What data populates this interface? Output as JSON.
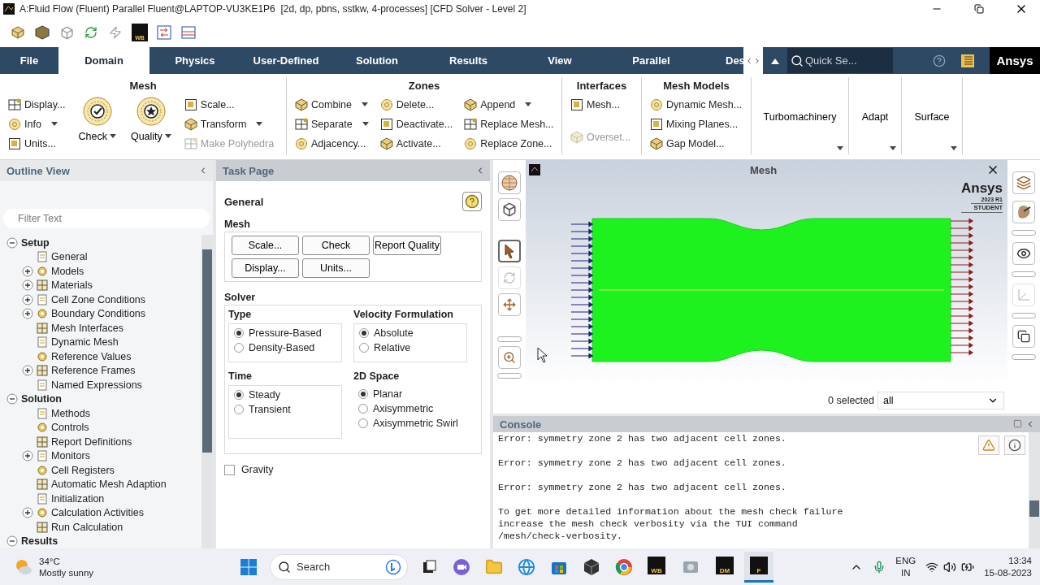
{
  "window": {
    "title": "A:Fluid Flow (Fluent) Parallel Fluent@LAPTOP-VU3KE1P6  [2d, dp, pbns, sstkw, 4-processes] [CFD Solver - Level 2]"
  },
  "quick_toolbar": {
    "badge": "WB"
  },
  "ribbon_tabs": [
    {
      "label": "File",
      "selected": false
    },
    {
      "label": "Domain",
      "selected": true
    },
    {
      "label": "Physics",
      "selected": false
    },
    {
      "label": "User-Defined",
      "selected": false
    },
    {
      "label": "Solution",
      "selected": false
    },
    {
      "label": "Results",
      "selected": false
    },
    {
      "label": "View",
      "selected": false
    },
    {
      "label": "Parallel",
      "selected": false
    },
    {
      "label": "Des",
      "selected": false
    }
  ],
  "quick_search": {
    "placeholder": "Quick Se..."
  },
  "brand": "Ansys",
  "ribbon_groups": [
    {
      "kind": "tools",
      "title": "Mesh",
      "columns": [
        [
          {
            "label": "Display...",
            "kind": "small",
            "dropdown": false,
            "disabled": false
          },
          {
            "label": "Info",
            "kind": "small",
            "dropdown": true,
            "disabled": false
          },
          {
            "label": "Units...",
            "kind": "small",
            "dropdown": false,
            "disabled": false
          }
        ],
        [
          {
            "label": "Check",
            "kind": "large",
            "dropdown": true,
            "disabled": false
          }
        ],
        [
          {
            "label": "Quality",
            "kind": "large",
            "dropdown": true,
            "disabled": false
          }
        ],
        [
          {
            "label": "Scale...",
            "kind": "small",
            "dropdown": false,
            "disabled": false
          },
          {
            "label": "Transform",
            "kind": "small",
            "dropdown": true,
            "disabled": false
          },
          {
            "label": "Make Polyhedra",
            "kind": "small",
            "dropdown": false,
            "disabled": true
          }
        ]
      ]
    },
    {
      "kind": "tools",
      "title": "Zones",
      "columns": [
        [
          {
            "label": "Combine",
            "kind": "small",
            "dropdown": true,
            "disabled": false
          },
          {
            "label": "Separate",
            "kind": "small",
            "dropdown": true,
            "disabled": false
          },
          {
            "label": "Adjacency...",
            "kind": "small",
            "dropdown": false,
            "disabled": false
          }
        ],
        [
          {
            "label": "Delete...",
            "kind": "small",
            "dropdown": false,
            "disabled": false
          },
          {
            "label": "Deactivate...",
            "kind": "small",
            "dropdown": false,
            "disabled": false
          },
          {
            "label": "Activate...",
            "kind": "small",
            "dropdown": false,
            "disabled": false
          }
        ],
        [
          {
            "label": "Append",
            "kind": "small",
            "dropdown": true,
            "disabled": false
          },
          {
            "label": "Replace Mesh...",
            "kind": "small",
            "dropdown": false,
            "disabled": false
          },
          {
            "label": "Replace Zone...",
            "kind": "small",
            "dropdown": false,
            "disabled": false
          }
        ]
      ]
    },
    {
      "kind": "tools",
      "title": "Interfaces",
      "columns": [
        [
          {
            "label": "Mesh...",
            "kind": "small",
            "dropdown": false,
            "disabled": false
          },
          {
            "label": "Overset...",
            "kind": "small",
            "dropdown": false,
            "disabled": true
          }
        ]
      ]
    },
    {
      "kind": "tools",
      "title": "Mesh Models",
      "columns": [
        [
          {
            "label": "Dynamic Mesh...",
            "kind": "small",
            "dropdown": false,
            "disabled": false
          },
          {
            "label": "Mixing Planes...",
            "kind": "small",
            "dropdown": false,
            "disabled": false
          },
          {
            "label": "Gap Model...",
            "kind": "small",
            "dropdown": false,
            "disabled": false
          }
        ]
      ]
    },
    {
      "kind": "menu",
      "title": "Turbomachinery"
    },
    {
      "kind": "menu",
      "title": "Adapt"
    },
    {
      "kind": "menu",
      "title": "Surface"
    }
  ],
  "outline": {
    "title": "Outline View",
    "filter_placeholder": "Filter Text",
    "tree": [
      {
        "label": "Setup",
        "kind": "folder",
        "expanded": true,
        "children": [
          {
            "label": "General",
            "kind": "leaf"
          },
          {
            "label": "Models",
            "kind": "folder",
            "expanded": false
          },
          {
            "label": "Materials",
            "kind": "folder",
            "expanded": false
          },
          {
            "label": "Cell Zone Conditions",
            "kind": "folder",
            "expanded": false
          },
          {
            "label": "Boundary Conditions",
            "kind": "folder",
            "expanded": false
          },
          {
            "label": "Mesh Interfaces",
            "kind": "leaf"
          },
          {
            "label": "Dynamic Mesh",
            "kind": "leaf"
          },
          {
            "label": "Reference Values",
            "kind": "leaf"
          },
          {
            "label": "Reference Frames",
            "kind": "folder",
            "expanded": false
          },
          {
            "label": "Named Expressions",
            "kind": "leaf"
          }
        ]
      },
      {
        "label": "Solution",
        "kind": "folder",
        "expanded": true,
        "children": [
          {
            "label": "Methods",
            "kind": "leaf"
          },
          {
            "label": "Controls",
            "kind": "leaf"
          },
          {
            "label": "Report Definitions",
            "kind": "leaf"
          },
          {
            "label": "Monitors",
            "kind": "folder",
            "expanded": false
          },
          {
            "label": "Cell Registers",
            "kind": "leaf"
          },
          {
            "label": "Automatic Mesh Adaption",
            "kind": "leaf"
          },
          {
            "label": "Initialization",
            "kind": "leaf"
          },
          {
            "label": "Calculation Activities",
            "kind": "folder",
            "expanded": false
          },
          {
            "label": "Run Calculation",
            "kind": "leaf"
          }
        ]
      },
      {
        "label": "Results",
        "kind": "folder",
        "expanded": true
      }
    ]
  },
  "task_page": {
    "title": "Task Page",
    "heading": "General",
    "mesh": {
      "label": "Mesh",
      "buttons": [
        "Scale...",
        "Check",
        "Report Quality",
        "Display...",
        "Units..."
      ]
    },
    "solver": {
      "label": "Solver",
      "groups": [
        {
          "title": "Type",
          "options": [
            {
              "label": "Pressure-Based",
              "selected": true
            },
            {
              "label": "Density-Based",
              "selected": false
            }
          ]
        },
        {
          "title": "Velocity Formulation",
          "options": [
            {
              "label": "Absolute",
              "selected": true
            },
            {
              "label": "Relative",
              "selected": false
            }
          ]
        },
        {
          "title": "Time",
          "options": [
            {
              "label": "Steady",
              "selected": true
            },
            {
              "label": "Transient",
              "selected": false
            }
          ]
        },
        {
          "title": "2D Space",
          "options": [
            {
              "label": "Planar",
              "selected": true
            },
            {
              "label": "Axisymmetric",
              "selected": false
            },
            {
              "label": "Axisymmetric Swirl",
              "selected": false
            }
          ]
        }
      ]
    },
    "gravity": {
      "label": "Gravity",
      "checked": false
    }
  },
  "graphics": {
    "title": "Mesh",
    "logo": {
      "brand": "Ansys",
      "version": "2023 R1",
      "edition": "STUDENT"
    },
    "left_tools": [
      {
        "selected": false,
        "disabled": false
      },
      {
        "selected": false,
        "disabled": false
      },
      {
        "selected": true,
        "disabled": false
      },
      {
        "selected": false,
        "disabled": true
      },
      {
        "selected": false,
        "disabled": false
      },
      {
        "selected": false,
        "disabled": false
      }
    ],
    "right_tools": [
      {
        "disabled": false
      },
      {
        "disabled": false
      },
      {
        "disabled": false
      },
      {
        "disabled": true
      },
      {
        "disabled": false
      }
    ],
    "selection": {
      "count": "0 selected",
      "filter": "all"
    }
  },
  "console": {
    "title": "Console",
    "paragraphs": [
      "Error: symmetry zone 2 has two adjacent cell zones.",
      "Error: symmetry zone 2 has two adjacent cell zones.",
      "Error: symmetry zone 2 has two adjacent cell zones.",
      "To get more detailed information about the mesh check failure\nincrease the mesh check verbosity via the TUI command\n/mesh/check-verbosity."
    ]
  },
  "taskbar": {
    "weather": {
      "temp": "34°C",
      "condition": "Mostly sunny"
    },
    "search": {
      "placeholder": "Search"
    },
    "apps": [
      {
        "label": "WB",
        "selected": false
      },
      {
        "label": "DM",
        "selected": false
      },
      {
        "label": "F",
        "selected": true
      }
    ],
    "tray": {
      "language": "ENG",
      "region": "IN",
      "time": "13:34",
      "date": "15-08-2023"
    }
  }
}
